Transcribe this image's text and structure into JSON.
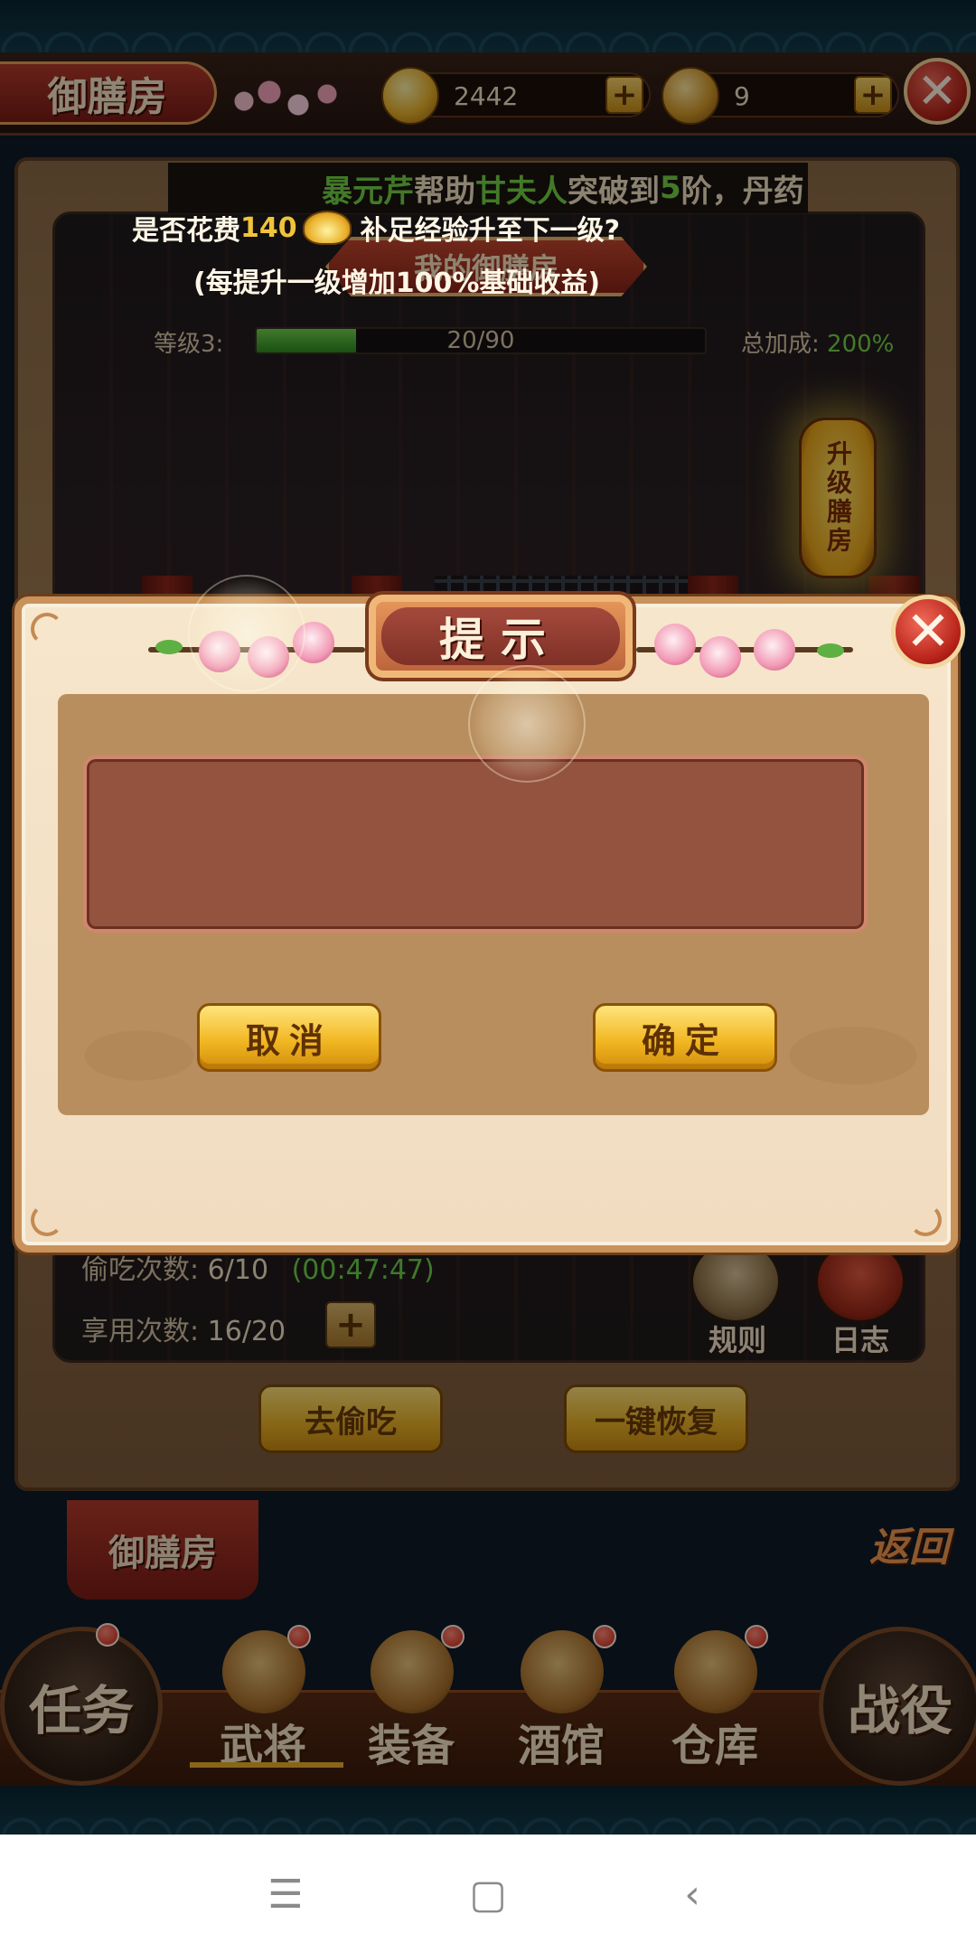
{
  "header": {
    "title": "御膳房",
    "gold_amount": "2442",
    "token_amount": "9",
    "plus_label": "+",
    "close_label": "✕"
  },
  "ticker": {
    "part1": "暴元芹",
    "part2": "帮助",
    "part3": "甘夫人",
    "part4": "突破到",
    "part5": "5",
    "part6": "阶，丹药"
  },
  "room": {
    "title": "我的御膳房",
    "level_label": "等级3:",
    "level_progress": "20/90",
    "level_fraction": 0.222,
    "bonus_label": "总加成:",
    "bonus_value": "200%",
    "upgrade_label": "升级膳房"
  },
  "stats": {
    "steal_label": "偷吃次数:",
    "steal_value": "6/10",
    "steal_timer": "(00:47:47)",
    "enjoy_label": "享用次数:",
    "enjoy_value": "16/20"
  },
  "side": {
    "rules": "规则",
    "log": "日志"
  },
  "panel_buttons": {
    "steal": "去偷吃",
    "restore": "一键恢复"
  },
  "section_tab": "御膳房",
  "back_label": "返回",
  "nav": {
    "tasks": "任务",
    "generals": "武将",
    "equipment": "装备",
    "tavern": "酒馆",
    "warehouse": "仓库",
    "battle": "战役"
  },
  "modal": {
    "title": "提示",
    "line1_prefix": "是否花费",
    "cost": "140",
    "line1_suffix": "补足经验升至下一级?",
    "line2": "(每提升一级增加100%基础收益)",
    "cancel": "取消",
    "confirm": "确定",
    "close": "✕"
  },
  "system_nav": {
    "menu": "☰",
    "home": "▢",
    "back": "‹"
  }
}
